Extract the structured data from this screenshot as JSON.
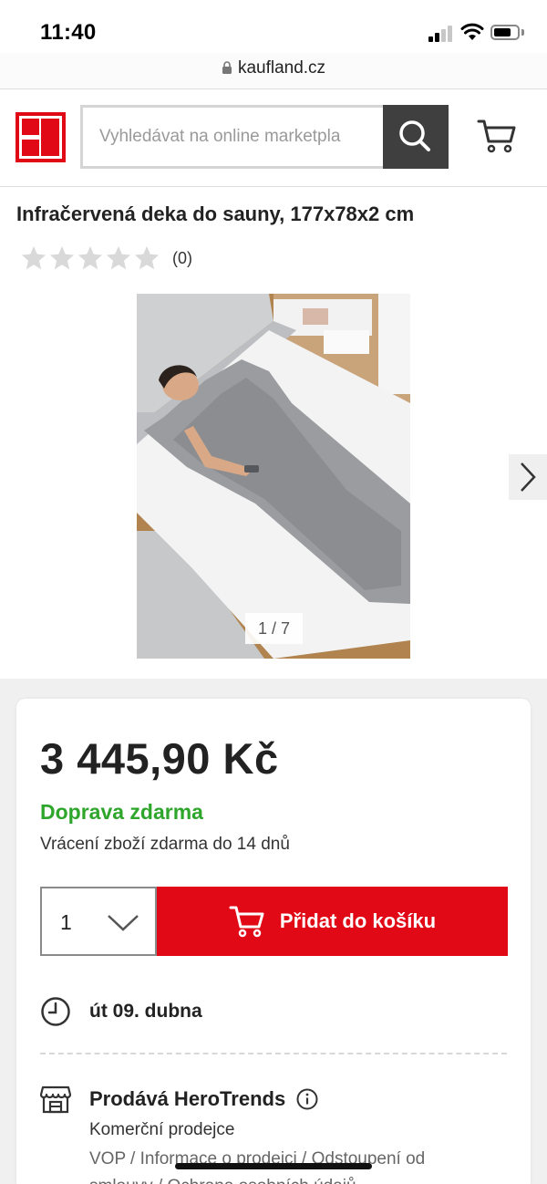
{
  "status_bar": {
    "time": "11:40"
  },
  "browser": {
    "url": "kaufland.cz"
  },
  "header": {
    "logo_alt": "Kaufland",
    "search_placeholder": "Vyhledávat na online marketpla"
  },
  "product": {
    "title": "Infračervená deka do sauny, 177x78x2 cm",
    "rating_count": "(0)",
    "stars_filled": 0,
    "stars_total": 5,
    "image_counter": "1 / 7"
  },
  "offer": {
    "price": "3 445,90 Kč",
    "shipping": "Doprava zdarma",
    "returns": "Vrácení zboží zdarma do 14 dnů",
    "quantity": "1",
    "add_to_cart_label": "Přidat do košíku",
    "delivery_date": "út 09. dubna",
    "seller_name": "Prodává HeroTrends",
    "seller_type": "Komerční prodejce",
    "seller_links": "VOP / Informace o prodejci / Odstoupení od",
    "seller_links_cont": "smlouvy / Ochrana osobních údajů"
  },
  "colors": {
    "brand_red": "#e10915",
    "shipping_green": "#2ea52b",
    "search_button": "#3f3f3f"
  }
}
